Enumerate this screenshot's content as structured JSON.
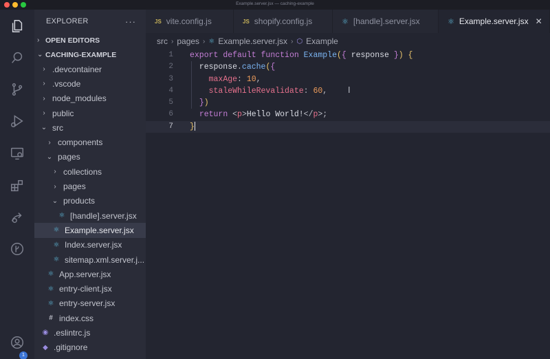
{
  "window": {
    "title": "Example.server.jsx — caching-example"
  },
  "explorer": {
    "title": "EXPLORER",
    "more": "···",
    "open_editors": "OPEN EDITORS",
    "project": "CACHING-EXAMPLE"
  },
  "tree": [
    {
      "label": ".devcontainer",
      "chev": "›",
      "icon": "",
      "indent": 1,
      "kind": "folder"
    },
    {
      "label": ".vscode",
      "chev": "›",
      "icon": "",
      "indent": 1,
      "kind": "folder"
    },
    {
      "label": "node_modules",
      "chev": "›",
      "icon": "",
      "indent": 1,
      "kind": "folder"
    },
    {
      "label": "public",
      "chev": "›",
      "icon": "",
      "indent": 1,
      "kind": "folder"
    },
    {
      "label": "src",
      "chev": "⌄",
      "icon": "",
      "indent": 1,
      "kind": "folder"
    },
    {
      "label": "components",
      "chev": "›",
      "icon": "",
      "indent": 2,
      "kind": "folder"
    },
    {
      "label": "pages",
      "chev": "⌄",
      "icon": "",
      "indent": 2,
      "kind": "folder"
    },
    {
      "label": "collections",
      "chev": "›",
      "icon": "",
      "indent": 3,
      "kind": "folder"
    },
    {
      "label": "pages",
      "chev": "›",
      "icon": "",
      "indent": 3,
      "kind": "folder"
    },
    {
      "label": "products",
      "chev": "⌄",
      "icon": "",
      "indent": 3,
      "kind": "folder"
    },
    {
      "label": "[handle].server.jsx",
      "chev": "",
      "icon": "⚛",
      "indent": 4,
      "kind": "react"
    },
    {
      "label": "Example.server.jsx",
      "chev": "",
      "icon": "⚛",
      "indent": 3,
      "kind": "react",
      "selected": true
    },
    {
      "label": "Index.server.jsx",
      "chev": "",
      "icon": "⚛",
      "indent": 3,
      "kind": "react"
    },
    {
      "label": "sitemap.xml.server.j...",
      "chev": "",
      "icon": "⚛",
      "indent": 3,
      "kind": "react"
    },
    {
      "label": "App.server.jsx",
      "chev": "",
      "icon": "⚛",
      "indent": 2,
      "kind": "react"
    },
    {
      "label": "entry-client.jsx",
      "chev": "",
      "icon": "⚛",
      "indent": 2,
      "kind": "react"
    },
    {
      "label": "entry-server.jsx",
      "chev": "",
      "icon": "⚛",
      "indent": 2,
      "kind": "react"
    },
    {
      "label": "index.css",
      "chev": "",
      "icon": "#",
      "indent": 2,
      "kind": "css"
    },
    {
      "label": ".eslintrc.js",
      "chev": "",
      "icon": "◉",
      "indent": 1,
      "kind": "eslint"
    },
    {
      "label": ".gitignore",
      "chev": "",
      "icon": "◆",
      "indent": 1,
      "kind": "git"
    }
  ],
  "tabs": [
    {
      "label": "vite.config.js",
      "icon": "JS",
      "active": false
    },
    {
      "label": "shopify.config.js",
      "icon": "JS",
      "active": false
    },
    {
      "label": "[handle].server.jsx",
      "icon": "⚛",
      "active": false
    },
    {
      "label": "Example.server.jsx",
      "icon": "⚛",
      "active": true,
      "close": "✕"
    }
  ],
  "breadcrumb": [
    "src",
    "pages",
    "Example.server.jsx",
    "Example"
  ],
  "code": {
    "current_line": 7,
    "lines": [
      {
        "n": "1",
        "tokens": [
          [
            "k",
            "export "
          ],
          [
            "k",
            "default "
          ],
          [
            "k",
            "function "
          ],
          [
            "f",
            "Example"
          ],
          [
            "p",
            "("
          ],
          [
            "k",
            "{ "
          ],
          [
            "v",
            "response "
          ],
          [
            "k",
            "}"
          ],
          [
            "p",
            ")"
          ],
          [
            "v",
            " "
          ],
          [
            "p",
            "{"
          ]
        ]
      },
      {
        "n": "2",
        "tokens": [
          [
            "v",
            "  response"
          ],
          [
            "pn",
            "."
          ],
          [
            "f",
            "cache"
          ],
          [
            "p",
            "("
          ],
          [
            "k",
            "{"
          ]
        ]
      },
      {
        "n": "3",
        "tokens": [
          [
            "v",
            "    "
          ],
          [
            "prop",
            "maxAge"
          ],
          [
            "pn",
            ": "
          ],
          [
            "n",
            "10"
          ],
          [
            "pn",
            ","
          ]
        ]
      },
      {
        "n": "4",
        "tokens": [
          [
            "v",
            "    "
          ],
          [
            "prop",
            "staleWhileRevalidate"
          ],
          [
            "pn",
            ": "
          ],
          [
            "n",
            "60"
          ],
          [
            "pn",
            ","
          ]
        ]
      },
      {
        "n": "5",
        "tokens": [
          [
            "v",
            "  "
          ],
          [
            "k",
            "}"
          ],
          [
            "p",
            ")"
          ]
        ]
      },
      {
        "n": "6",
        "tokens": [
          [
            "v",
            "  "
          ],
          [
            "k",
            "return "
          ],
          [
            "pn",
            "<"
          ],
          [
            "tg",
            "p"
          ],
          [
            "pn",
            ">"
          ],
          [
            "v",
            "Hello World!"
          ],
          [
            "pn",
            "</"
          ],
          [
            "tg",
            "p"
          ],
          [
            "pn",
            ">"
          ],
          [
            "pn",
            ";"
          ]
        ]
      },
      {
        "n": "7",
        "tokens": [
          [
            "p",
            "}"
          ]
        ]
      }
    ]
  },
  "colors": {
    "accent": "#3a74d6",
    "react": "#5fb9d9",
    "background": "#232530",
    "sidebar": "#2a2c38"
  },
  "account_badge": "1"
}
